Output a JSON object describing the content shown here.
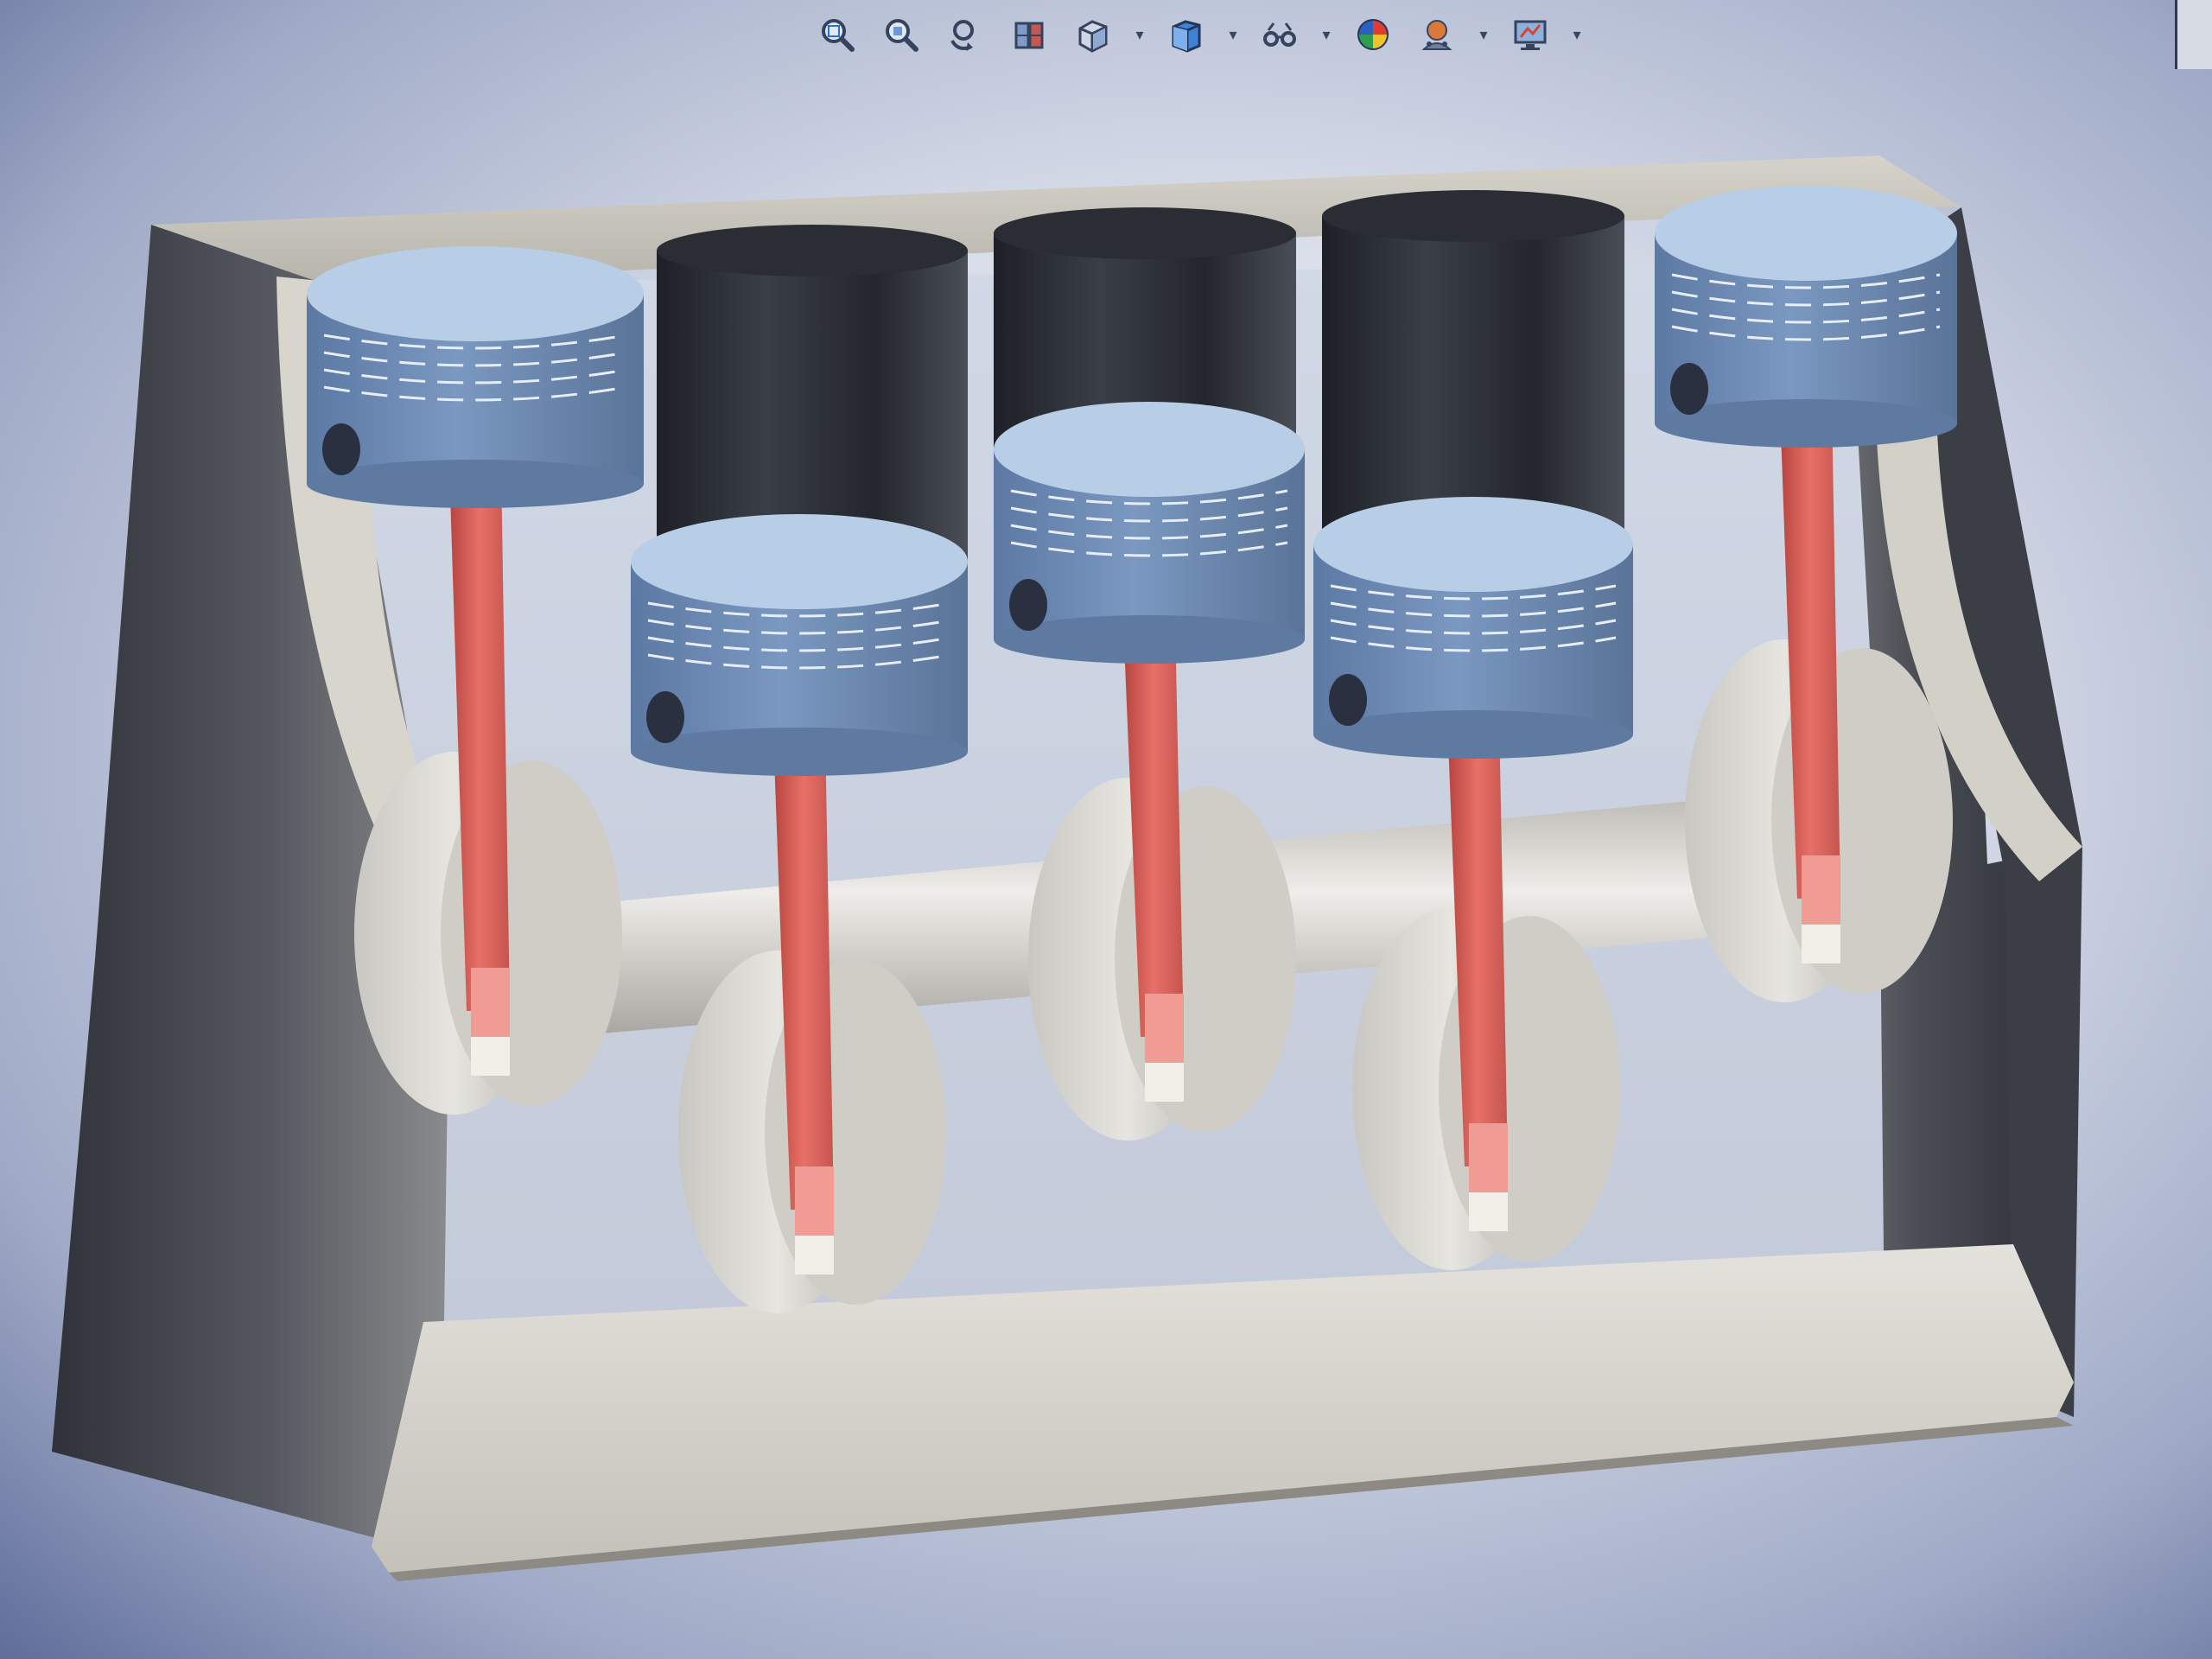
{
  "window": {
    "name": "cad-3d-viewport"
  },
  "toolbar": {
    "buttons": [
      {
        "icon": "zoom-to-fit-icon",
        "dropdown": false
      },
      {
        "icon": "zoom-to-area-icon",
        "dropdown": false
      },
      {
        "icon": "previous-view-icon",
        "dropdown": false
      },
      {
        "icon": "section-view-icon",
        "dropdown": false
      },
      {
        "icon": "view-orientation-icon",
        "dropdown": true
      },
      {
        "icon": "display-style-icon",
        "dropdown": true
      },
      {
        "icon": "hide-show-items-icon",
        "dropdown": true
      },
      {
        "icon": "edit-appearance-icon",
        "dropdown": false
      },
      {
        "icon": "apply-scene-icon",
        "dropdown": true
      },
      {
        "icon": "view-settings-icon",
        "dropdown": true
      }
    ],
    "dropdown_glyph": "▾"
  },
  "model": {
    "subject": "inline-five-cylinder-engine-assembly",
    "colors": {
      "background": "#d9deea",
      "block": "#c9c6bd",
      "block_shadow": "#3d3f45",
      "piston_top": "#b8cde6",
      "piston_side": "#6f8db4",
      "cylinder_bore": "#35383f",
      "connecting_rod": "#e06a63",
      "crankshaft": "#d8d7d2"
    }
  }
}
